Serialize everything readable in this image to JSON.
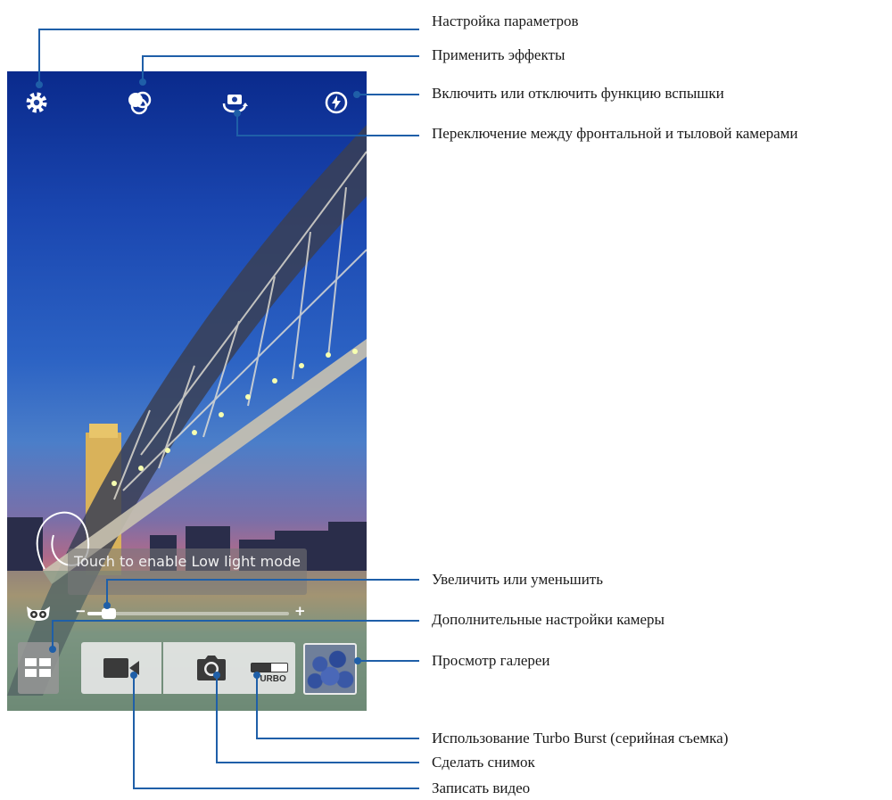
{
  "camera": {
    "lowlight_hint": "Touch to enable Low light mode",
    "zoom": {
      "minus": "−",
      "plus": "+",
      "level": 0.08
    },
    "turbo_label": "TURBO",
    "turbo_enabled": false,
    "icons": {
      "settings": "gear-icon",
      "effects": "effects-icon",
      "switch_camera": "camera-switch-icon",
      "flash": "flash-auto-icon",
      "low_light": "owl-icon",
      "more_settings": "grid-icon",
      "video": "video-camera-icon",
      "shutter": "camera-icon",
      "gallery": "gallery-thumbnail"
    }
  },
  "callouts": {
    "settings": "Настройка параметров",
    "effects": "Применить эффекты",
    "flash": "Включить или отключить функцию вспышки",
    "switch_camera": "Переключение между фронтальной и тыловой камерами",
    "zoom": "Увеличить или уменьшить",
    "advanced": "Дополнительные настройки камеры",
    "gallery": "Просмотр галереи",
    "turbo": "Использование Turbo Burst (серийная съемка)",
    "shutter": "Сделать снимок",
    "video": "Записать видео"
  },
  "colors": {
    "callout_line": "#1f5fa8"
  }
}
